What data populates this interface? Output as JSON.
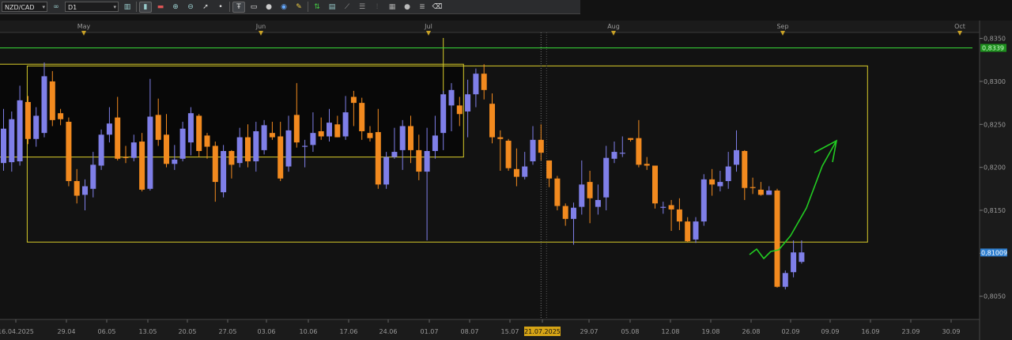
{
  "toolbar": {
    "symbol": "NZD/CAD",
    "timeframe": "D1",
    "buttons": [
      "link-icon",
      "bar-chart-icon",
      "line-chart-icon",
      "zoom-in-icon",
      "zoom-out-icon",
      "cursor-icon",
      "dot-icon",
      "text-tool-icon",
      "note-icon",
      "circle-icon",
      "pencil-icon",
      "indicator-icon",
      "grid-icon",
      "fibonacci-icon",
      "channel-icon",
      "settings-icon",
      "globe-icon",
      "template-icon",
      "eraser-icon"
    ]
  },
  "colors": {
    "background": "#121212",
    "bull": "#7f7fe8",
    "bear": "#f28a1f",
    "box": "#d8cc2a",
    "hline": "#34c934",
    "arrow": "#22cc22",
    "price_badge": "#2f7fd0",
    "date_badge": "#d6a416"
  },
  "chart_data": {
    "type": "candlestick",
    "symbol": "NZD/CAD",
    "timeframe": "D1",
    "y_ticks": [
      "0,8350",
      "0,8300",
      "0,8250",
      "0,8200",
      "0,8150",
      "0,8100",
      "0,8050"
    ],
    "ylim": [
      0.8023,
      0.8357
    ],
    "current_price_label": "0,81009",
    "hline_label": "0,8339",
    "hline_price": 0.8339,
    "month_labels": [
      "May",
      "Jun",
      "Jul",
      "Aug",
      "Sep",
      "Oct"
    ],
    "x_labels": [
      "16.04.2025",
      "29.04",
      "06.05",
      "13.05",
      "20.05",
      "27.05",
      "03.06",
      "10.06",
      "17.06",
      "24.06",
      "01.07",
      "08.07",
      "15.07",
      "21.07.2025",
      "29.07",
      "05.08",
      "12.08",
      "19.08",
      "26.08",
      "02.09",
      "09.09",
      "16.09",
      "23.09",
      "30.09"
    ],
    "highlighted_date": "21.07.2025",
    "candles": [
      {
        "o": 0.8205,
        "c": 0.8245,
        "h": 0.8268,
        "l": 0.8196
      },
      {
        "o": 0.8206,
        "c": 0.8256,
        "h": 0.8265,
        "l": 0.8195
      },
      {
        "o": 0.8207,
        "c": 0.8278,
        "h": 0.8295,
        "l": 0.8202
      },
      {
        "o": 0.8276,
        "c": 0.8233,
        "h": 0.8283,
        "l": 0.8227
      },
      {
        "o": 0.8233,
        "c": 0.826,
        "h": 0.827,
        "l": 0.8224
      },
      {
        "o": 0.824,
        "c": 0.8306,
        "h": 0.8322,
        "l": 0.8235
      },
      {
        "o": 0.83,
        "c": 0.8255,
        "h": 0.8312,
        "l": 0.8248
      },
      {
        "o": 0.8263,
        "c": 0.8256,
        "h": 0.8268,
        "l": 0.8249
      },
      {
        "o": 0.8253,
        "c": 0.8184,
        "h": 0.8258,
        "l": 0.8178
      },
      {
        "o": 0.8184,
        "c": 0.8167,
        "h": 0.8198,
        "l": 0.8158
      },
      {
        "o": 0.8168,
        "c": 0.8178,
        "h": 0.8186,
        "l": 0.815
      },
      {
        "o": 0.8175,
        "c": 0.8203,
        "h": 0.8218,
        "l": 0.8165
      },
      {
        "o": 0.8202,
        "c": 0.8238,
        "h": 0.8244,
        "l": 0.8197
      },
      {
        "o": 0.8238,
        "c": 0.8251,
        "h": 0.827,
        "l": 0.8229
      },
      {
        "o": 0.8258,
        "c": 0.821,
        "h": 0.8282,
        "l": 0.8208
      },
      {
        "o": 0.8212,
        "c": 0.8211,
        "h": 0.8225,
        "l": 0.8205
      },
      {
        "o": 0.8211,
        "c": 0.8229,
        "h": 0.8238,
        "l": 0.8207
      },
      {
        "o": 0.823,
        "c": 0.8174,
        "h": 0.824,
        "l": 0.8172
      },
      {
        "o": 0.8175,
        "c": 0.8259,
        "h": 0.8303,
        "l": 0.8173
      },
      {
        "o": 0.8261,
        "c": 0.8232,
        "h": 0.828,
        "l": 0.8225
      },
      {
        "o": 0.8238,
        "c": 0.8204,
        "h": 0.8262,
        "l": 0.82
      },
      {
        "o": 0.8204,
        "c": 0.8209,
        "h": 0.8226,
        "l": 0.8197
      },
      {
        "o": 0.821,
        "c": 0.8245,
        "h": 0.8253,
        "l": 0.8207
      },
      {
        "o": 0.8229,
        "c": 0.8263,
        "h": 0.827,
        "l": 0.8214
      },
      {
        "o": 0.826,
        "c": 0.8219,
        "h": 0.8262,
        "l": 0.8212
      },
      {
        "o": 0.8237,
        "c": 0.8224,
        "h": 0.824,
        "l": 0.821
      },
      {
        "o": 0.8225,
        "c": 0.8183,
        "h": 0.823,
        "l": 0.816
      },
      {
        "o": 0.8171,
        "c": 0.8219,
        "h": 0.8226,
        "l": 0.8165
      },
      {
        "o": 0.8219,
        "c": 0.8203,
        "h": 0.822,
        "l": 0.8187
      },
      {
        "o": 0.8205,
        "c": 0.8235,
        "h": 0.8246,
        "l": 0.82
      },
      {
        "o": 0.8235,
        "c": 0.8207,
        "h": 0.825,
        "l": 0.82
      },
      {
        "o": 0.8207,
        "c": 0.8242,
        "h": 0.8253,
        "l": 0.8195
      },
      {
        "o": 0.822,
        "c": 0.8249,
        "h": 0.8255,
        "l": 0.8215
      },
      {
        "o": 0.824,
        "c": 0.8235,
        "h": 0.8253,
        "l": 0.8232
      },
      {
        "o": 0.8236,
        "c": 0.8187,
        "h": 0.8253,
        "l": 0.8184
      },
      {
        "o": 0.8201,
        "c": 0.8243,
        "h": 0.826,
        "l": 0.8195
      },
      {
        "o": 0.8261,
        "c": 0.8229,
        "h": 0.8298,
        "l": 0.8223
      },
      {
        "o": 0.8224,
        "c": 0.8225,
        "h": 0.8232,
        "l": 0.82
      },
      {
        "o": 0.8226,
        "c": 0.824,
        "h": 0.8264,
        "l": 0.8218
      },
      {
        "o": 0.8242,
        "c": 0.8236,
        "h": 0.8258,
        "l": 0.8232
      },
      {
        "o": 0.8236,
        "c": 0.8252,
        "h": 0.8268,
        "l": 0.823
      },
      {
        "o": 0.825,
        "c": 0.8235,
        "h": 0.826,
        "l": 0.8235
      },
      {
        "o": 0.8236,
        "c": 0.8264,
        "h": 0.8283,
        "l": 0.8232
      },
      {
        "o": 0.8282,
        "c": 0.8275,
        "h": 0.8289,
        "l": 0.8248
      },
      {
        "o": 0.8275,
        "c": 0.8242,
        "h": 0.8281,
        "l": 0.8232
      },
      {
        "o": 0.824,
        "c": 0.8234,
        "h": 0.8248,
        "l": 0.823
      },
      {
        "o": 0.8241,
        "c": 0.818,
        "h": 0.8268,
        "l": 0.8175
      },
      {
        "o": 0.818,
        "c": 0.8212,
        "h": 0.8218,
        "l": 0.8175
      },
      {
        "o": 0.8212,
        "c": 0.8218,
        "h": 0.8246,
        "l": 0.821
      },
      {
        "o": 0.822,
        "c": 0.8248,
        "h": 0.8255,
        "l": 0.8197
      },
      {
        "o": 0.8248,
        "c": 0.822,
        "h": 0.826,
        "l": 0.8205
      },
      {
        "o": 0.822,
        "c": 0.8195,
        "h": 0.8238,
        "l": 0.8185
      },
      {
        "o": 0.8195,
        "c": 0.8219,
        "h": 0.8246,
        "l": 0.8115
      },
      {
        "o": 0.8219,
        "c": 0.8237,
        "h": 0.826,
        "l": 0.821
      },
      {
        "o": 0.824,
        "c": 0.8285,
        "h": 0.8289,
        "l": 0.822
      },
      {
        "o": 0.8272,
        "c": 0.829,
        "h": 0.8298,
        "l": 0.8242
      },
      {
        "o": 0.8272,
        "c": 0.8262,
        "h": 0.8282,
        "l": 0.8248
      },
      {
        "o": 0.8265,
        "c": 0.8285,
        "h": 0.8302,
        "l": 0.8235
      },
      {
        "o": 0.8285,
        "c": 0.8309,
        "h": 0.8315,
        "l": 0.827
      },
      {
        "o": 0.8309,
        "c": 0.829,
        "h": 0.832,
        "l": 0.8279
      },
      {
        "o": 0.8274,
        "c": 0.8235,
        "h": 0.8286,
        "l": 0.8228
      },
      {
        "o": 0.8235,
        "c": 0.8233,
        "h": 0.8243,
        "l": 0.8196
      },
      {
        "o": 0.8231,
        "c": 0.8199,
        "h": 0.8233,
        "l": 0.8196
      },
      {
        "o": 0.8198,
        "c": 0.8189,
        "h": 0.8222,
        "l": 0.8178
      },
      {
        "o": 0.8189,
        "c": 0.8201,
        "h": 0.8218,
        "l": 0.8186
      },
      {
        "o": 0.8207,
        "c": 0.8232,
        "h": 0.8248,
        "l": 0.8203
      },
      {
        "o": 0.8232,
        "c": 0.8217,
        "h": 0.825,
        "l": 0.8208
      },
      {
        "o": 0.8208,
        "c": 0.8187,
        "h": 0.8208,
        "l": 0.8177
      },
      {
        "o": 0.8187,
        "c": 0.8155,
        "h": 0.819,
        "l": 0.815
      },
      {
        "o": 0.8155,
        "c": 0.814,
        "h": 0.8158,
        "l": 0.8132
      },
      {
        "o": 0.814,
        "c": 0.8153,
        "h": 0.8159,
        "l": 0.811
      },
      {
        "o": 0.8154,
        "c": 0.818,
        "h": 0.8208,
        "l": 0.8145
      },
      {
        "o": 0.8183,
        "c": 0.8164,
        "h": 0.8196,
        "l": 0.8135
      },
      {
        "o": 0.8154,
        "c": 0.8162,
        "h": 0.818,
        "l": 0.8145
      },
      {
        "o": 0.8165,
        "c": 0.8211,
        "h": 0.8225,
        "l": 0.815
      },
      {
        "o": 0.821,
        "c": 0.8218,
        "h": 0.823,
        "l": 0.8205
      },
      {
        "o": 0.8216,
        "c": 0.8217,
        "h": 0.8236,
        "l": 0.8212
      },
      {
        "o": 0.8234,
        "c": 0.8232,
        "h": 0.8234,
        "l": 0.823
      },
      {
        "o": 0.8234,
        "c": 0.8203,
        "h": 0.8255,
        "l": 0.82
      },
      {
        "o": 0.8204,
        "c": 0.8202,
        "h": 0.8212,
        "l": 0.8197
      },
      {
        "o": 0.8202,
        "c": 0.8158,
        "h": 0.8202,
        "l": 0.8152
      },
      {
        "o": 0.8153,
        "c": 0.8154,
        "h": 0.816,
        "l": 0.8146
      },
      {
        "o": 0.8156,
        "c": 0.8151,
        "h": 0.8162,
        "l": 0.8126
      },
      {
        "o": 0.8151,
        "c": 0.8137,
        "h": 0.8164,
        "l": 0.8127
      },
      {
        "o": 0.8137,
        "c": 0.8114,
        "h": 0.8142,
        "l": 0.8113
      },
      {
        "o": 0.8116,
        "c": 0.8137,
        "h": 0.8142,
        "l": 0.8112
      },
      {
        "o": 0.8137,
        "c": 0.8186,
        "h": 0.8192,
        "l": 0.8132
      },
      {
        "o": 0.8186,
        "c": 0.818,
        "h": 0.8198,
        "l": 0.8167
      },
      {
        "o": 0.8178,
        "c": 0.8183,
        "h": 0.8196,
        "l": 0.8172
      },
      {
        "o": 0.8184,
        "c": 0.8201,
        "h": 0.8218,
        "l": 0.8175
      },
      {
        "o": 0.8203,
        "c": 0.822,
        "h": 0.8243,
        "l": 0.8195
      },
      {
        "o": 0.8219,
        "c": 0.8176,
        "h": 0.822,
        "l": 0.8162
      },
      {
        "o": 0.8177,
        "c": 0.8176,
        "h": 0.8188,
        "l": 0.8169
      },
      {
        "o": 0.8174,
        "c": 0.8168,
        "h": 0.8183,
        "l": 0.8167
      },
      {
        "o": 0.8168,
        "c": 0.8173,
        "h": 0.8178,
        "l": 0.8168
      },
      {
        "o": 0.8173,
        "c": 0.8061,
        "h": 0.8175,
        "l": 0.806
      },
      {
        "o": 0.8061,
        "c": 0.8077,
        "h": 0.808,
        "l": 0.8058
      },
      {
        "o": 0.8078,
        "c": 0.8101,
        "h": 0.8115,
        "l": 0.8072
      },
      {
        "o": 0.809,
        "c": 0.8101,
        "h": 0.8115,
        "l": 0.8088
      }
    ],
    "range_box_upper_left": {
      "start_index": 0,
      "end_index": 56,
      "top": 0.832,
      "bottom": 0.8212
    },
    "range_box_main": {
      "start_index": 3,
      "end_index": 106,
      "top": 0.8318,
      "bottom": 0.8113
    },
    "forecast_path": [
      [
        0.8085
      ],
      [
        0.8095
      ],
      [
        0.808
      ],
      [
        0.8095
      ],
      [
        0.8105
      ],
      [
        0.8125
      ],
      [
        0.817
      ],
      [
        0.8215
      ],
      [
        0.8238
      ]
    ],
    "grid": false
  }
}
